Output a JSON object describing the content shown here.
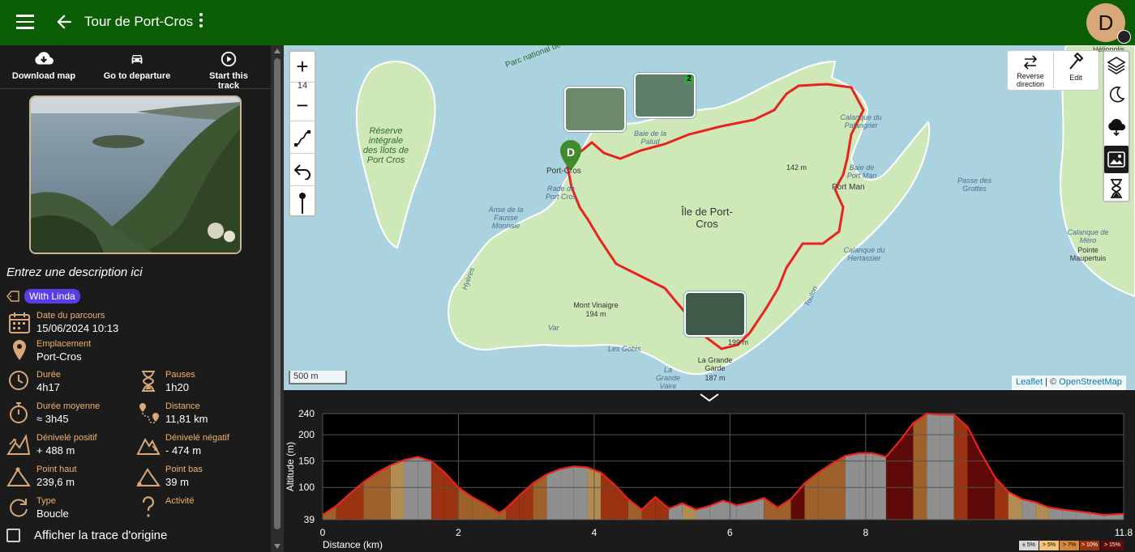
{
  "header": {
    "title": "Tour de Port-Cros",
    "avatar_letter": "D"
  },
  "actions": {
    "download": "Download map",
    "departure": "Go to departure",
    "start": "Start this track"
  },
  "description": "Entrez une description ici",
  "tag": "With Linda",
  "stats": {
    "date_label": "Date du parcours",
    "date_value": "15/06/2024 10:13",
    "location_label": "Emplacement",
    "location_value": "Port-Cros",
    "duration_label": "Durée",
    "duration_value": "4h17",
    "pauses_label": "Pauses",
    "pauses_value": "1h20",
    "avg_label": "Durée moyenne",
    "avg_value": "≈ 3h45",
    "distance_label": "Distance",
    "distance_value": "11,81 km",
    "dplus_label": "Dénivelé positif",
    "dplus_value": "+ 488 m",
    "dminus_label": "Dénivelé négatif",
    "dminus_value": "- 474 m",
    "high_label": "Point haut",
    "high_value": "239,6 m",
    "low_label": "Point bas",
    "low_value": "39 m",
    "type_label": "Type",
    "type_value": "Boucle",
    "activity_label": "Activité"
  },
  "original_trace": "Afficher la trace d'origine",
  "map": {
    "zoom_level": "14",
    "scale": "500 m",
    "reverse": "Reverse direction",
    "edit": "Edit",
    "attrib_leaflet": "Leaflet",
    "attrib_sep": " | © ",
    "attrib_osm": "OpenStreetMap",
    "photo_badge": "2",
    "start_marker": "D",
    "labels": {
      "island": "Île de Port-Cros",
      "reserve": "Réserve intégrale des îlots de Port Cros",
      "park": "Parc national de Port-Cros (coeur terrestre et marin)",
      "port_cros": "Port-Cros",
      "port_man": "Port Man",
      "rade": "Rade de Port Cros",
      "baie_paluds": "Baie de la Palud",
      "anse": "Anse de la Fausse Monnaie",
      "calanque_pal": "Calanque du Palangrier",
      "baie_port_man": "Baie de Port Man",
      "passe": "Passe des Grottes",
      "mont": "Mont Vinaigre",
      "mont_alt": "194 m",
      "garde": "La Grande Garde",
      "garde_alt": "187 m",
      "vinaigre_alt": "199 m",
      "gobis": "Les Gobis",
      "vaire": "La Grande Vaire",
      "sommet": "142 m",
      "calanque_hert": "Calanque du Hertassier",
      "pointe": "Pointe Maupertuis",
      "calanque_mero": "Calanque de Méro",
      "heliopolis": "Héliopolis",
      "hyeres": "Hyères",
      "toulon": "Toulon",
      "var": "Var"
    }
  },
  "chart_data": {
    "type": "area",
    "xlabel": "Distance (km)",
    "ylabel": "Altitude (m)",
    "xlim": [
      0,
      11.8
    ],
    "ylim": [
      39,
      240
    ],
    "x_ticks": [
      "0",
      "2",
      "4",
      "6",
      "8",
      "11.8"
    ],
    "y_ticks": [
      "39",
      "100",
      "150",
      "200",
      "240"
    ],
    "x": [
      0,
      0.2,
      0.4,
      0.6,
      0.8,
      1.0,
      1.2,
      1.4,
      1.6,
      1.8,
      2.0,
      2.2,
      2.4,
      2.6,
      2.7,
      2.9,
      3.1,
      3.3,
      3.5,
      3.7,
      3.9,
      4.1,
      4.3,
      4.5,
      4.7,
      4.9,
      5.1,
      5.3,
      5.5,
      5.7,
      5.9,
      6.1,
      6.3,
      6.5,
      6.7,
      6.9,
      7.1,
      7.3,
      7.5,
      7.7,
      7.9,
      8.1,
      8.3,
      8.5,
      8.7,
      8.9,
      9.1,
      9.3,
      9.5,
      9.7,
      9.9,
      10.1,
      10.3,
      10.5,
      10.7,
      10.9,
      11.1,
      11.3,
      11.5,
      11.8
    ],
    "y": [
      48,
      65,
      88,
      110,
      128,
      142,
      152,
      158,
      150,
      128,
      100,
      82,
      68,
      52,
      60,
      85,
      108,
      125,
      135,
      140,
      138,
      128,
      105,
      78,
      58,
      82,
      60,
      70,
      58,
      65,
      75,
      66,
      72,
      80,
      62,
      78,
      108,
      128,
      145,
      160,
      165,
      165,
      158,
      188,
      222,
      240,
      238,
      238,
      215,
      165,
      120,
      92,
      78,
      72,
      62,
      58,
      55,
      52,
      48,
      50
    ],
    "legend": [
      "± 5%",
      "> 5%",
      "> 7%",
      "> 10%",
      "> 15%"
    ],
    "legend_colors": [
      "#d8d8d8",
      "#f5c37a",
      "#d4863a",
      "#9b3312",
      "#5e0a08"
    ]
  }
}
